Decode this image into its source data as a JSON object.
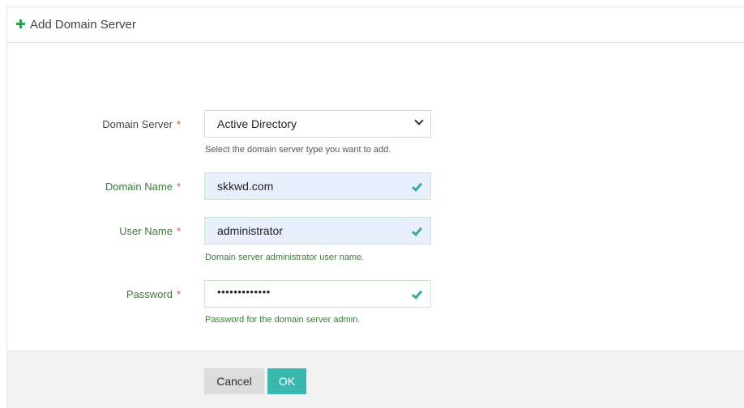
{
  "header": {
    "title": "Add Domain Server",
    "icon": "plus-icon",
    "icon_color": "#2e9e55"
  },
  "form": {
    "domain_server": {
      "label": "Domain Server",
      "required_mark": "*",
      "value": "Active Directory",
      "help": "Select the domain server type you want to add."
    },
    "domain_name": {
      "label": "Domain Name",
      "required_mark": "*",
      "value": "skkwd.com"
    },
    "user_name": {
      "label": "User Name",
      "required_mark": "*",
      "value": "administrator",
      "help": "Domain server administrator user name."
    },
    "password": {
      "label": "Password",
      "required_mark": "*",
      "value": "•••••••••••••",
      "help": "Password for the domain server admin."
    }
  },
  "footer": {
    "cancel_label": "Cancel",
    "ok_label": "OK",
    "ok_color": "#3ab8ad"
  }
}
